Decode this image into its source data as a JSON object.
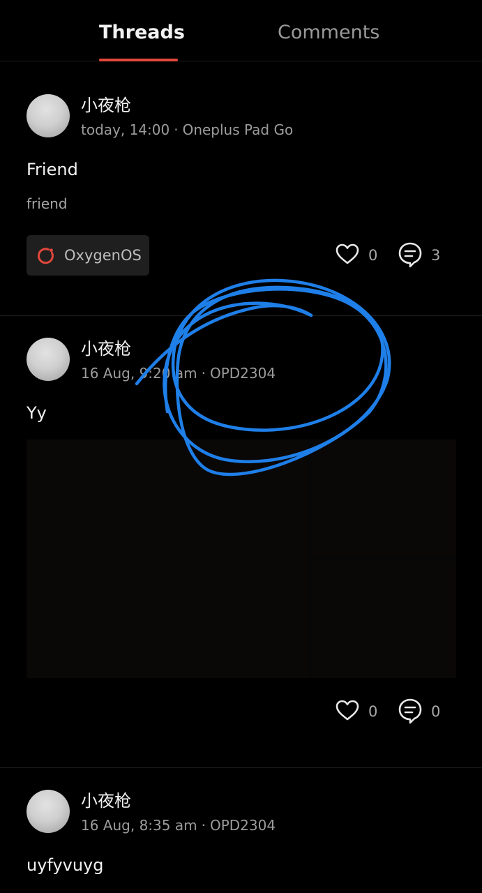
{
  "colors": {
    "accent": "#e2473b",
    "background": "#000000",
    "scribble": "#1f7fe8"
  },
  "tabs": [
    {
      "label": "Threads",
      "active": true
    },
    {
      "label": "Comments",
      "active": false
    }
  ],
  "posts": [
    {
      "username": "小夜枪",
      "time": "today, 14:00",
      "separator": "·",
      "device": "Oneplus Pad Go",
      "title": "Friend",
      "body": "friend",
      "tag": {
        "label": "OxygenOS",
        "icon": "oxygenos-logo-icon"
      },
      "likes": "0",
      "comments": "3"
    },
    {
      "username": "小夜枪",
      "time": "16 Aug, 9:20 am",
      "separator": "·",
      "device": "OPD2304",
      "title": "Yy",
      "has_image": true,
      "likes": "0",
      "comments": "0"
    },
    {
      "username": "小夜枪",
      "time": "16 Aug, 8:35 am",
      "separator": "·",
      "device": "OPD2304",
      "title": "uyfyvuyg"
    }
  ]
}
